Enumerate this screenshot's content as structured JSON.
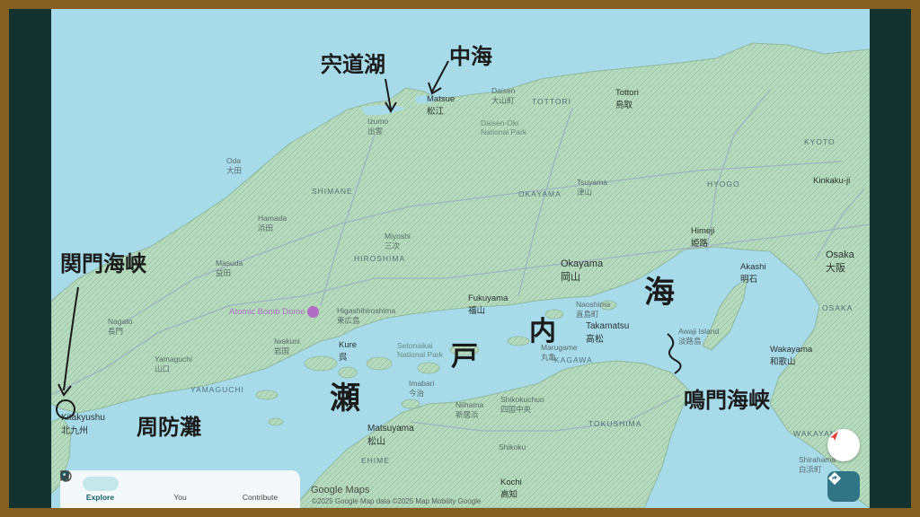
{
  "map_labels": {
    "matsue": "Matsue",
    "matsue_jp": "松江",
    "izumo": "Izumo",
    "izumo_jp": "出雲",
    "daisen": "Daisen",
    "daisen_jp": "大山町",
    "tottori_pref": "TOTTORI",
    "tottori": "Tottori",
    "tottori_jp": "鳥取",
    "park1": "Daisen-Oki",
    "park2": "National Park",
    "oda": "Oda",
    "oda_jp": "大田",
    "shimane": "SHIMANE",
    "okayama_pref": "OKAYAMA",
    "tsuyama": "Tsuyama",
    "tsuyama_jp": "津山",
    "hyogo": "HYOGO",
    "kyoto": "KYOTO",
    "kinkakuji": "Kinkaku-ji",
    "hamada": "Hamada",
    "hamada_jp": "浜田",
    "miyoshi": "Miyoshi",
    "miyoshi_jp": "三次",
    "hiroshima_pref": "HIROSHIMA",
    "himeji": "Himeji",
    "himeji_jp": "姫路",
    "okayama": "Okayama",
    "okayama_jp": "岡山",
    "osaka": "Osaka",
    "osaka_jp": "大阪",
    "masuda": "Masuda",
    "masuda_jp": "益田",
    "akashi": "Akashi",
    "akashi_jp": "明石",
    "fukuyama": "Fukuyama",
    "fukuyama_jp": "福山",
    "naoshima": "Naoshima",
    "naoshima_jp": "直島町",
    "osaka_pref": "OSAKA",
    "nagato": "Nagato",
    "nagato_jp": "長門",
    "atomic_dome": "Atomic Bomb Dome",
    "higashihiroshima": "Higashihiroshima",
    "higashihiroshima_jp": "東広島",
    "takamatsu": "Takamatsu",
    "takamatsu_jp": "高松",
    "awaji": "Awaji Island",
    "awaji_jp": "淡路島",
    "iwakuni": "Iwakuni",
    "iwakuni_jp": "岩国",
    "kure": "Kure",
    "kure_jp": "呉",
    "setonaikai1": "Setonaikai",
    "setonaikai2": "National Park",
    "marugame": "Marugame",
    "marugame_jp": "丸亀",
    "yamaguchi": "Yamaguchi",
    "yamaguchi_jp": "山口",
    "kagawa": "KAGAWA",
    "wakayama": "Wakayama",
    "wakayama_jp": "和歌山",
    "yamaguchi_pref": "YAMAGUCHI",
    "imabari": "Imabari",
    "imabari_jp": "今治",
    "kitakyushu": "Kitakyushu",
    "kitakyushu_jp": "北九州",
    "niihama": "Niihama",
    "niihama_jp": "新居浜",
    "shikokuchuo": "Shikokuchuo",
    "shikokuchuo_jp": "四国中央",
    "matsuyama": "Matsuyama",
    "matsuyama_jp": "松山",
    "tokushima": "TOKUSHIMA",
    "ehime": "EHIME",
    "shikoku": "Shikoku",
    "wakayama_pref": "WAKAYAMA",
    "kochi": "Kochi",
    "kochi_jp": "高知",
    "shirahama": "Shirahama",
    "shirahama_jp": "白浜町"
  },
  "handwriting": {
    "shinjiko": "宍道湖",
    "nakaumi": "中海",
    "kanmon": "関門海峡",
    "suonada": "周防灘",
    "se": "瀬",
    "to": "戸",
    "uchi": "内",
    "umi": "海",
    "naruto": "鳴門海峡"
  },
  "nav": {
    "explore": "Explore",
    "you": "You",
    "contribute": "Contribute"
  },
  "attribution": {
    "logo": "Google Maps",
    "credit": "©2025 Google  Map data ©2025 Map Mobility  Google"
  },
  "colors": {
    "frame": "#866020",
    "water": "#a7dbe9",
    "land": "#b9dcc0",
    "accent": "#1a73e8"
  }
}
